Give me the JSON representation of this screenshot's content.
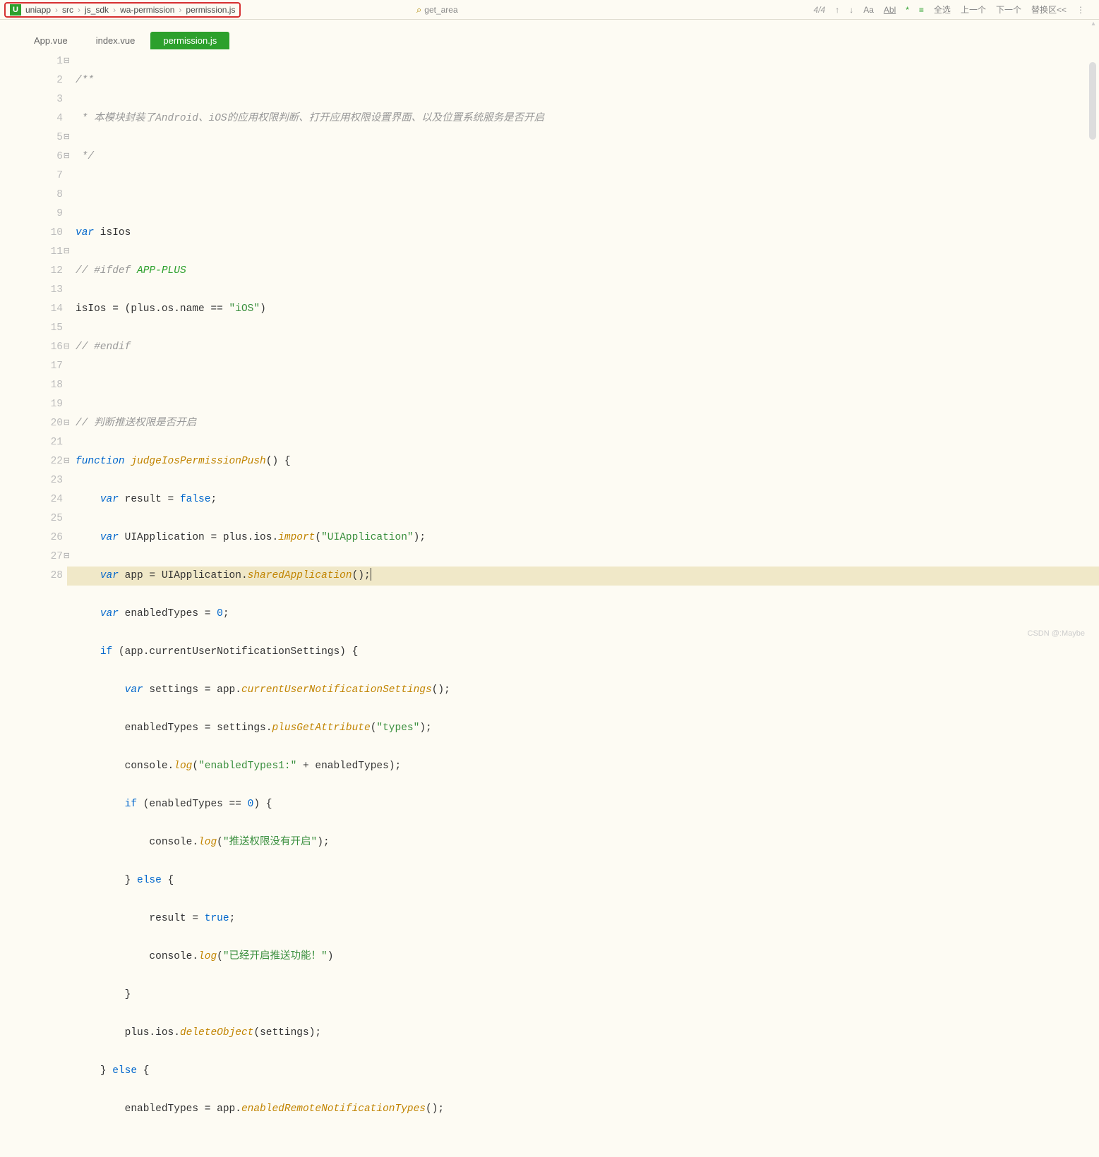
{
  "breadcrumb": {
    "parts": [
      "uniapp",
      "src",
      "js_sdk",
      "wa-permission",
      "permission.js"
    ]
  },
  "search": {
    "placeholder": "get_area"
  },
  "toolbar": {
    "count": "4/4",
    "aa": "Aa",
    "abl": "Abl",
    "star": "*",
    "menu": "≡",
    "selectAll": "全选",
    "prev": "上一个",
    "next": "下一个",
    "replace": "替换区<<"
  },
  "tabs": [
    {
      "label": "App.vue",
      "active": false
    },
    {
      "label": "index.vue",
      "active": false
    },
    {
      "label": "permission.js",
      "active": true
    }
  ],
  "code": {
    "lines": [
      {
        "num": 1,
        "fold": "⊟"
      },
      {
        "num": 2
      },
      {
        "num": 3
      },
      {
        "num": 4
      },
      {
        "num": 5,
        "fold": "⊟"
      },
      {
        "num": 6,
        "fold": "⊟"
      },
      {
        "num": 7
      },
      {
        "num": 8
      },
      {
        "num": 9
      },
      {
        "num": 10
      },
      {
        "num": 11,
        "fold": "⊟"
      },
      {
        "num": 12
      },
      {
        "num": 13
      },
      {
        "num": 14
      },
      {
        "num": 15
      },
      {
        "num": 16,
        "fold": "⊟"
      },
      {
        "num": 17
      },
      {
        "num": 18
      },
      {
        "num": 19
      },
      {
        "num": 20,
        "fold": "⊟"
      },
      {
        "num": 21
      },
      {
        "num": 22,
        "fold": "⊟"
      },
      {
        "num": 23
      },
      {
        "num": 24
      },
      {
        "num": 25
      },
      {
        "num": 26
      },
      {
        "num": 27,
        "fold": "⊟"
      },
      {
        "num": 28
      }
    ],
    "text": {
      "l1": "/**",
      "l2": " * 本模块封装了Android、iOS的应用权限判断、打开应用权限设置界面、以及位置系统服务是否开启",
      "l3": " */",
      "l5a": "var",
      "l5b": " isIos",
      "l6a": "// #ifdef",
      "l6b": " APP-PLUS",
      "l7a": "isIos = (plus.os.name == ",
      "l7b": "\"iOS\"",
      "l7c": ")",
      "l8": "// #endif",
      "l10": "// 判断推送权限是否开启",
      "l11a": "function",
      "l11b": " judgeIosPermissionPush",
      "l11c": "() {",
      "l12a": "var",
      "l12b": " result = ",
      "l12c": "false",
      "l12d": ";",
      "l13a": "var",
      "l13b": " UIApplication = plus.ios.",
      "l13c": "import",
      "l13d": "(",
      "l13e": "\"UIApplication\"",
      "l13f": ");",
      "l14a": "var",
      "l14b": " app = UIApplication.",
      "l14c": "sharedApplication",
      "l14d": "();",
      "l15a": "var",
      "l15b": " enabledTypes = ",
      "l15c": "0",
      "l15d": ";",
      "l16a": "if",
      "l16b": " (app.currentUserNotificationSettings) {",
      "l17a": "var",
      "l17b": " settings = app.",
      "l17c": "currentUserNotificationSettings",
      "l17d": "();",
      "l18a": "enabledTypes = settings.",
      "l18b": "plusGetAttribute",
      "l18c": "(",
      "l18d": "\"types\"",
      "l18e": ");",
      "l19a": "console.",
      "l19b": "log",
      "l19c": "(",
      "l19d": "\"enabledTypes1:\"",
      "l19e": " + enabledTypes);",
      "l20a": "if",
      "l20b": " (enabledTypes == ",
      "l20c": "0",
      "l20d": ") {",
      "l21a": "console.",
      "l21b": "log",
      "l21c": "(",
      "l21d": "\"推送权限没有开启\"",
      "l21e": ");",
      "l22a": "} ",
      "l22b": "else",
      "l22c": " {",
      "l23a": "result = ",
      "l23b": "true",
      "l23c": ";",
      "l24a": "console.",
      "l24b": "log",
      "l24c": "(",
      "l24d": "\"已经开启推送功能！\"",
      "l24e": ")",
      "l25": "}",
      "l26a": "plus.ios.",
      "l26b": "deleteObject",
      "l26c": "(settings);",
      "l27a": "} ",
      "l27b": "else",
      "l27c": " {",
      "l28a": "enabledTypes = app.",
      "l28b": "enabledRemoteNotificationTypes",
      "l28c": "();"
    }
  },
  "watermark": "CSDN @:Maybe"
}
